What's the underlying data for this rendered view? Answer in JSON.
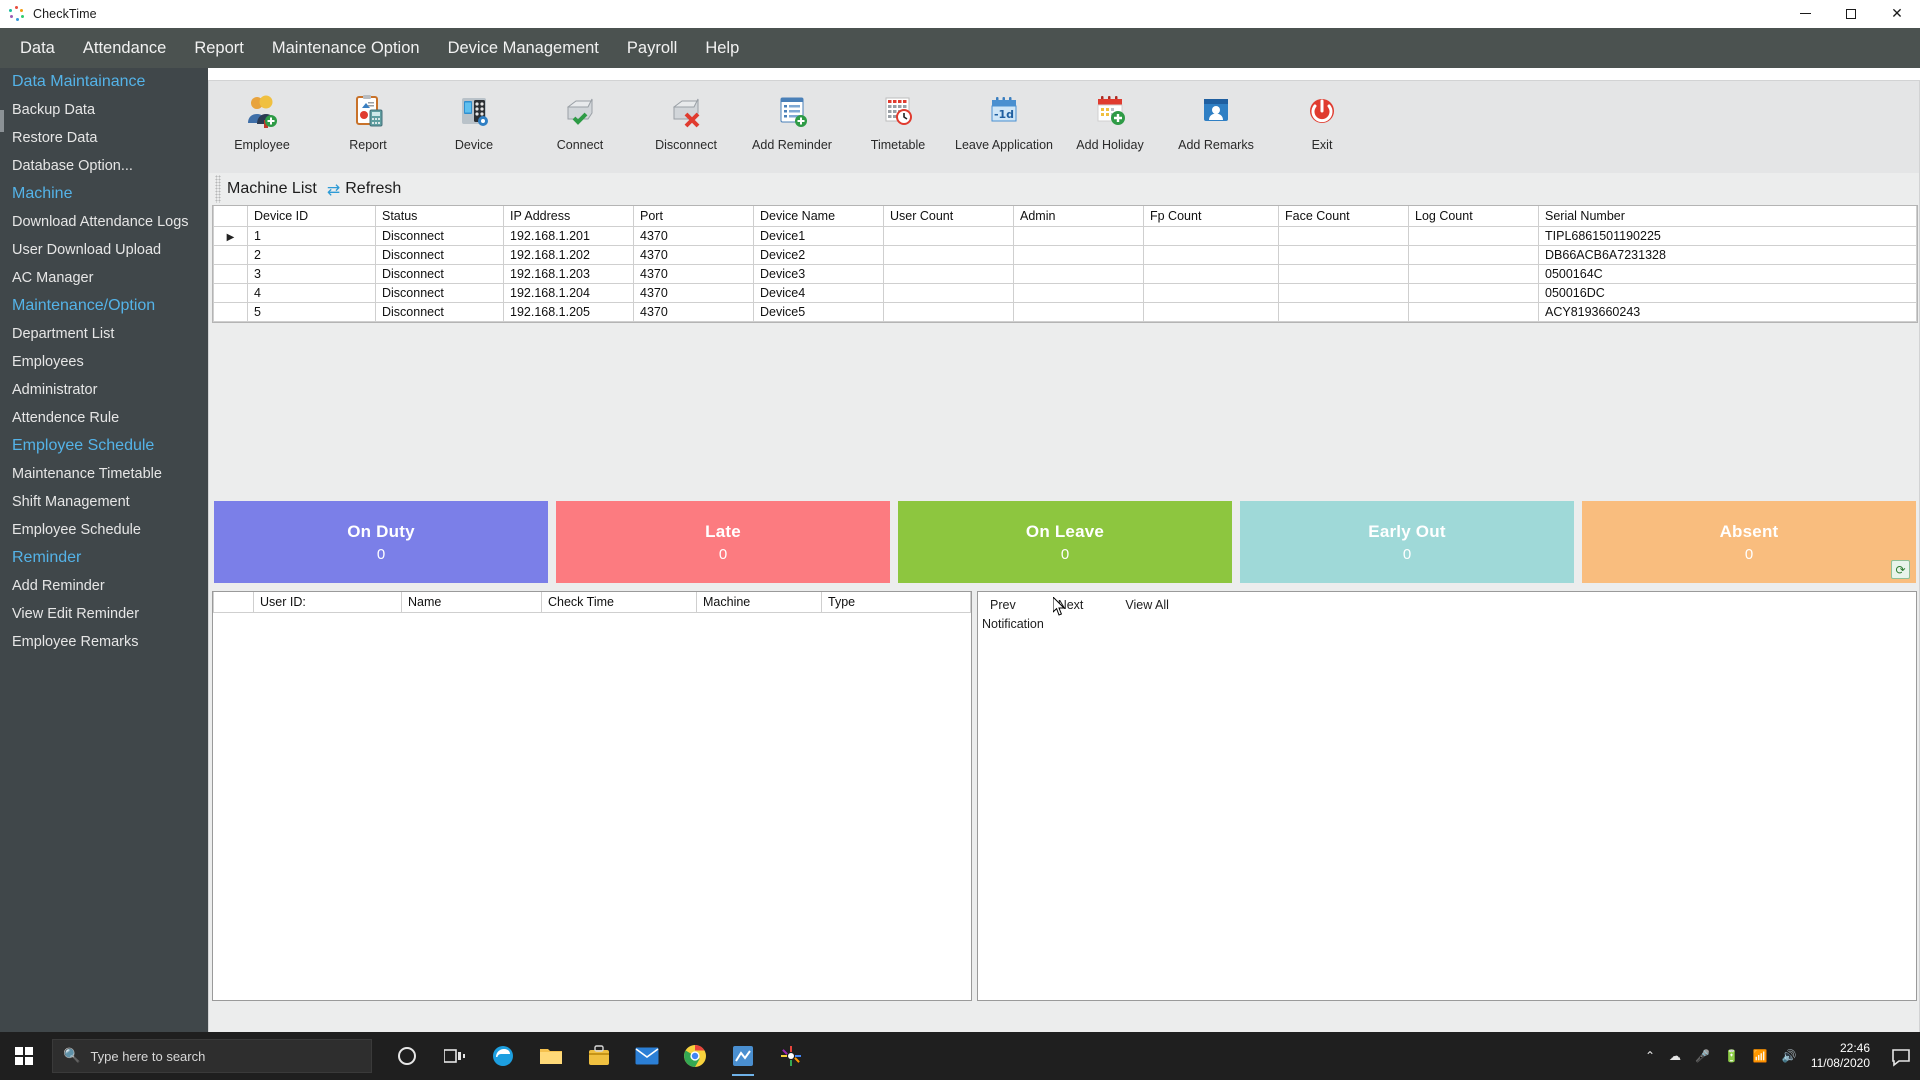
{
  "window": {
    "title": "CheckTime",
    "logo_icon": "checktime-logo-icon",
    "minimize_icon": "minimize-icon",
    "maximize_icon": "maximize-icon",
    "close_icon": "close-icon"
  },
  "menubar": {
    "items": [
      {
        "label": "Data",
        "name": "menu-data"
      },
      {
        "label": "Attendance",
        "name": "menu-attendance"
      },
      {
        "label": "Report",
        "name": "menu-report"
      },
      {
        "label": "Maintenance Option",
        "name": "menu-maintenance-option"
      },
      {
        "label": "Device Management",
        "name": "menu-device-management"
      },
      {
        "label": "Payroll",
        "name": "menu-payroll"
      },
      {
        "label": "Help",
        "name": "menu-help"
      }
    ]
  },
  "sidebar": {
    "groups": [
      {
        "title": "Data Maintainance",
        "items": [
          "Backup Data",
          "Restore Data",
          "Database Option..."
        ]
      },
      {
        "title": "Machine",
        "items": [
          "Download Attendance Logs",
          "User Download Upload",
          "AC Manager"
        ]
      },
      {
        "title": "Maintenance/Option",
        "items": [
          "Department List",
          "Employees",
          "Administrator",
          "Attendence Rule"
        ]
      },
      {
        "title": "Employee Schedule",
        "items": [
          "Maintenance Timetable",
          "Shift Management",
          "Employee Schedule"
        ]
      },
      {
        "title": "Reminder",
        "items": [
          "Add Reminder",
          "View Edit Reminder",
          "Employee Remarks"
        ]
      }
    ]
  },
  "toolbar": {
    "buttons": [
      {
        "label": "Employee",
        "icon": "employee-icon"
      },
      {
        "label": "Report",
        "icon": "report-icon"
      },
      {
        "label": "Device",
        "icon": "device-icon"
      },
      {
        "label": "Connect",
        "icon": "connect-icon"
      },
      {
        "label": "Disconnect",
        "icon": "disconnect-icon"
      },
      {
        "label": "Add Reminder",
        "icon": "add-reminder-icon"
      },
      {
        "label": "Timetable",
        "icon": "timetable-icon"
      },
      {
        "label": "Leave Application",
        "icon": "leave-application-icon"
      },
      {
        "label": "Add Holiday",
        "icon": "add-holiday-icon"
      },
      {
        "label": "Add Remarks",
        "icon": "add-remarks-icon"
      },
      {
        "label": "Exit",
        "icon": "exit-icon"
      }
    ]
  },
  "machine_list": {
    "title": "Machine List",
    "refresh_label": "Refresh",
    "refresh_icon": "refresh-icon",
    "columns": [
      "Device ID",
      "Status",
      "IP Address",
      "Port",
      "Device Name",
      "User Count",
      "Admin",
      "Fp Count",
      "Face Count",
      "Log Count",
      "Serial Number"
    ],
    "rows": [
      {
        "selected": true,
        "device_id": "1",
        "status": "Disconnect",
        "ip": "192.168.1.201",
        "port": "4370",
        "device_name": "Device1",
        "user_count": "",
        "admin": "",
        "fp_count": "",
        "face_count": "",
        "log_count": "",
        "serial": "TIPL6861501190225"
      },
      {
        "selected": false,
        "device_id": "2",
        "status": "Disconnect",
        "ip": "192.168.1.202",
        "port": "4370",
        "device_name": "Device2",
        "user_count": "",
        "admin": "",
        "fp_count": "",
        "face_count": "",
        "log_count": "",
        "serial": "DB66ACB6A7231328"
      },
      {
        "selected": false,
        "device_id": "3",
        "status": "Disconnect",
        "ip": "192.168.1.203",
        "port": "4370",
        "device_name": "Device3",
        "user_count": "",
        "admin": "",
        "fp_count": "",
        "face_count": "",
        "log_count": "",
        "serial": "0500164C"
      },
      {
        "selected": false,
        "device_id": "4",
        "status": "Disconnect",
        "ip": "192.168.1.204",
        "port": "4370",
        "device_name": "Device4",
        "user_count": "",
        "admin": "",
        "fp_count": "",
        "face_count": "",
        "log_count": "",
        "serial": "050016DC"
      },
      {
        "selected": false,
        "device_id": "5",
        "status": "Disconnect",
        "ip": "192.168.1.205",
        "port": "4370",
        "device_name": "Device5",
        "user_count": "",
        "admin": "",
        "fp_count": "",
        "face_count": "",
        "log_count": "",
        "serial": "ACY8193660243"
      }
    ]
  },
  "tiles": [
    {
      "label": "On Duty",
      "count": "0",
      "color": "#7b7fe8"
    },
    {
      "label": "Late",
      "count": "0",
      "color": "#fc7b80"
    },
    {
      "label": "On Leave",
      "count": "0",
      "color": "#8dc63f"
    },
    {
      "label": "Early Out",
      "count": "0",
      "color": "#9fd9d8"
    },
    {
      "label": "Absent",
      "count": "0",
      "color": "#f9bd7e",
      "badge_icon": "refresh-badge-icon"
    }
  ],
  "attendance_grid": {
    "columns": [
      "User ID:",
      "Name",
      "Check Time",
      "Machine",
      "Type"
    ],
    "rows": []
  },
  "notification": {
    "prev_label": "Prev",
    "next_label": "Next",
    "view_all_label": "View All",
    "title": "Notification"
  },
  "taskbar": {
    "start_icon": "windows-start-icon",
    "search_placeholder": "Type here to search",
    "search_icon": "search-icon",
    "items": [
      {
        "icon": "cortana-icon"
      },
      {
        "icon": "task-view-icon"
      },
      {
        "icon": "edge-icon"
      },
      {
        "icon": "file-explorer-icon"
      },
      {
        "icon": "microsoft-store-icon"
      },
      {
        "icon": "mail-icon"
      },
      {
        "icon": "chrome-icon"
      },
      {
        "icon": "checktime-app-icon"
      },
      {
        "icon": "photos-icon"
      }
    ],
    "tray": [
      {
        "icon": "chevron-up-icon"
      },
      {
        "icon": "cloud-icon"
      },
      {
        "icon": "microphone-icon"
      },
      {
        "icon": "battery-icon"
      },
      {
        "icon": "network-icon"
      },
      {
        "icon": "volume-icon"
      }
    ],
    "time": "22:46",
    "date": "11/08/2020",
    "action_center_icon": "action-center-icon"
  }
}
